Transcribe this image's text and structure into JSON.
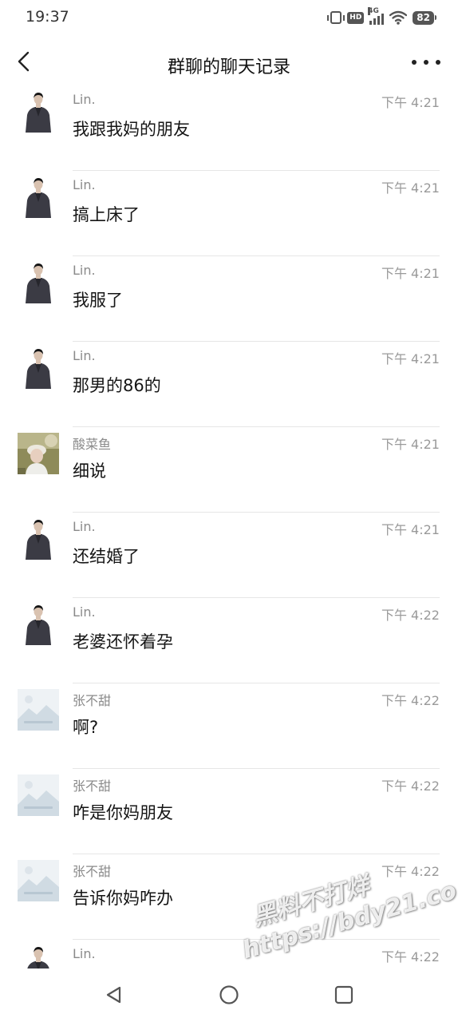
{
  "status_bar": {
    "time": "19:37",
    "hd_label": "HD",
    "network_label": "4G",
    "battery": "82"
  },
  "header": {
    "title": "群聊的聊天记录",
    "back_icon": "chevron-left-icon",
    "more_icon": "more-dots-icon"
  },
  "messages": [
    {
      "sender": "Lin.",
      "time": "下午 4:21",
      "text": "我跟我妈的朋友",
      "avatar": "lin"
    },
    {
      "sender": "Lin.",
      "time": "下午 4:21",
      "text": "搞上床了",
      "avatar": "lin"
    },
    {
      "sender": "Lin.",
      "time": "下午 4:21",
      "text": "我服了",
      "avatar": "lin"
    },
    {
      "sender": "Lin.",
      "time": "下午 4:21",
      "text": "那男的86的",
      "avatar": "lin"
    },
    {
      "sender": "酸菜鱼",
      "time": "下午 4:21",
      "text": "细说",
      "avatar": "photo"
    },
    {
      "sender": "Lin.",
      "time": "下午 4:21",
      "text": "还结婚了",
      "avatar": "lin"
    },
    {
      "sender": "Lin.",
      "time": "下午 4:22",
      "text": "老婆还怀着孕",
      "avatar": "lin"
    },
    {
      "sender": "张不甜",
      "time": "下午 4:22",
      "text": "啊?",
      "avatar": "placeholder"
    },
    {
      "sender": "张不甜",
      "time": "下午 4:22",
      "text": "咋是你妈朋友",
      "avatar": "placeholder"
    },
    {
      "sender": "张不甜",
      "time": "下午 4:22",
      "text": "告诉你妈咋办",
      "avatar": "placeholder"
    },
    {
      "sender": "Lin.",
      "time": "下午 4:22",
      "text": "",
      "avatar": "lin"
    }
  ],
  "watermark": {
    "line1": "黑料不打烊",
    "line2": "https://bdy21.co"
  },
  "system_nav": {
    "back_icon": "triangle-back-icon",
    "home_icon": "circle-home-icon",
    "recents_icon": "square-recents-icon"
  },
  "colors": {
    "background": "#ffffff",
    "sender_text": "#8a8a8a",
    "time_text": "#9a9a9a",
    "message_text": "#151515",
    "divider": "#e6e6e6"
  }
}
